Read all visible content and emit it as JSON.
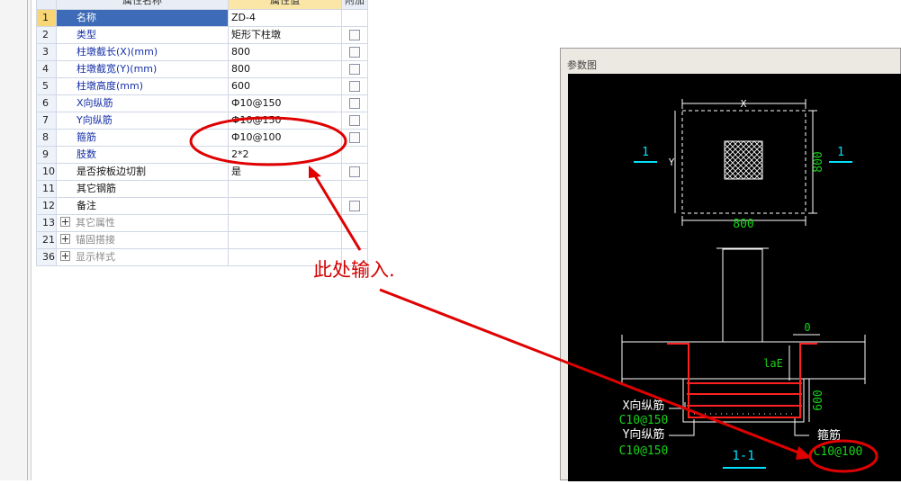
{
  "header": {
    "name_col": "属性名称",
    "value_col": "属性值",
    "attach_col": "附加"
  },
  "rows": [
    {
      "num": "1",
      "name": "名称",
      "value": "ZD-4",
      "cb": false
    },
    {
      "num": "2",
      "name": "类型",
      "value": "矩形下柱墩",
      "cb": true
    },
    {
      "num": "3",
      "name": "柱墩截长(X)(mm)",
      "value": "800",
      "cb": true
    },
    {
      "num": "4",
      "name": "柱墩截宽(Y)(mm)",
      "value": "800",
      "cb": true
    },
    {
      "num": "5",
      "name": "柱墩高度(mm)",
      "value": "600",
      "cb": true
    },
    {
      "num": "6",
      "name": "X向纵筋",
      "value": "Ф10@150",
      "cb": true
    },
    {
      "num": "7",
      "name": "Y向纵筋",
      "value": "Ф10@150",
      "cb": true
    },
    {
      "num": "8",
      "name": "箍筋",
      "value": "Ф10@100",
      "cb": true
    },
    {
      "num": "9",
      "name": "肢数",
      "value": "2*2",
      "cb": false
    },
    {
      "num": "10",
      "name": "是否按板边切割",
      "value": "是",
      "cb": true
    },
    {
      "num": "11",
      "name": "其它钢筋",
      "value": "",
      "cb": false
    },
    {
      "num": "12",
      "name": "备注",
      "value": "",
      "cb": true
    },
    {
      "num": "13",
      "name": "其它属性",
      "value": "",
      "cb": false
    },
    {
      "num": "21",
      "name": "锚固搭接",
      "value": "",
      "cb": false
    },
    {
      "num": "36",
      "name": "显示样式",
      "value": "",
      "cb": false
    }
  ],
  "panel": {
    "title": "参数图"
  },
  "drawing": {
    "x_label": "X",
    "y_label": "Y",
    "dim_800_h": "800",
    "dim_800_v": "800",
    "section_mark_left": "1",
    "section_mark_right": "1",
    "dim_0": "0",
    "lae": "laE",
    "dim_600": "600",
    "x_rebar_label": "X向纵筋",
    "x_rebar_value": "C10@150",
    "y_rebar_label": "Y向纵筋",
    "y_rebar_value": "C10@150",
    "stirrup_label": "箍筋",
    "stirrup_value": "C10@100",
    "section_title": "1-1"
  },
  "annotation": {
    "text": "此处输入."
  },
  "colors": {
    "selected_row": "#3d6bb7",
    "annotation_red": "#e00000",
    "cad_cyan": "#00e0ff",
    "cad_green": "#19d219",
    "cad_red": "#ff2020"
  }
}
